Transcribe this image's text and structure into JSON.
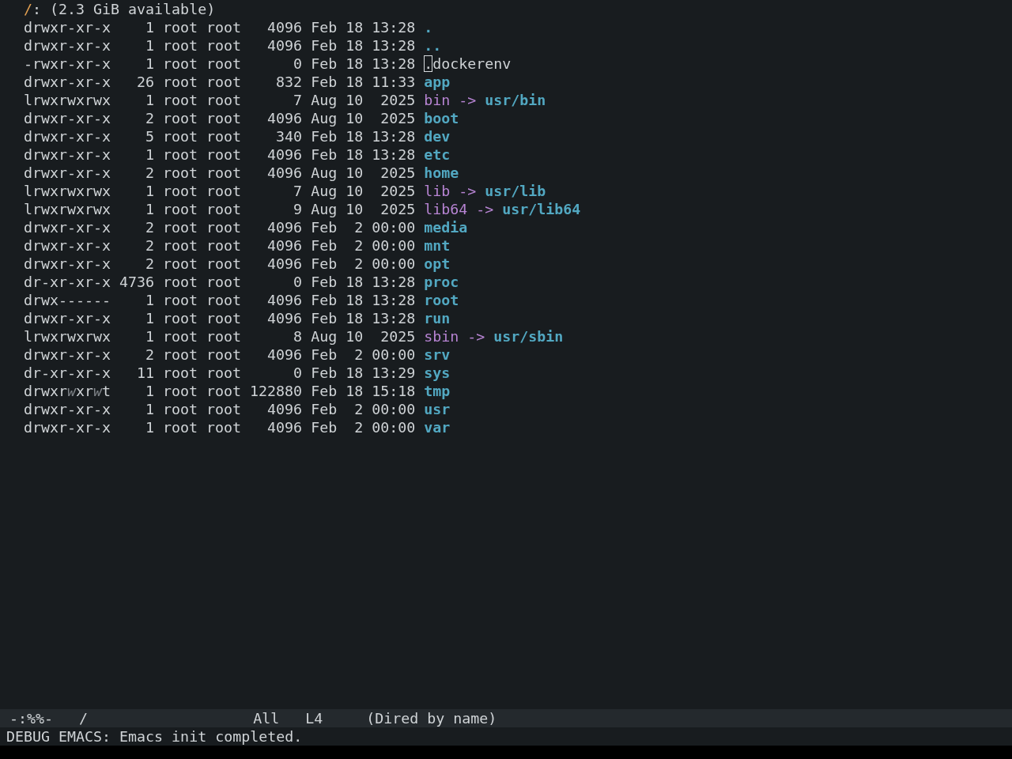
{
  "header": {
    "directory": "/",
    "info": ": (2.3 GiB available)"
  },
  "rows": [
    {
      "kind": "directory",
      "selected": false,
      "permissions": "drwxr-xr-x",
      "links": "1",
      "owner": "root",
      "group": "root",
      "size": "4096",
      "month": "Feb",
      "day": "18",
      "time": "13:28",
      "name": "."
    },
    {
      "kind": "directory",
      "selected": false,
      "permissions": "drwxr-xr-x",
      "links": "1",
      "owner": "root",
      "group": "root",
      "size": "4096",
      "month": "Feb",
      "day": "18",
      "time": "13:28",
      "name": ".."
    },
    {
      "kind": "file",
      "selected": true,
      "permissions": "-rwxr-xr-x",
      "links": "1",
      "owner": "root",
      "group": "root",
      "size": "0",
      "month": "Feb",
      "day": "18",
      "time": "13:28",
      "name": ".dockerenv"
    },
    {
      "kind": "directory",
      "selected": false,
      "permissions": "drwxr-xr-x",
      "links": "26",
      "owner": "root",
      "group": "root",
      "size": "832",
      "month": "Feb",
      "day": "18",
      "time": "11:33",
      "name": "app"
    },
    {
      "kind": "symlink",
      "selected": false,
      "permissions": "lrwxrwxrwx",
      "links": "1",
      "owner": "root",
      "group": "root",
      "size": "7",
      "month": "Aug",
      "day": "10",
      "time": "2025",
      "name": "bin",
      "arrow": "->",
      "target": "usr/bin"
    },
    {
      "kind": "directory",
      "selected": false,
      "permissions": "drwxr-xr-x",
      "links": "2",
      "owner": "root",
      "group": "root",
      "size": "4096",
      "month": "Aug",
      "day": "10",
      "time": "2025",
      "name": "boot"
    },
    {
      "kind": "directory",
      "selected": false,
      "permissions": "drwxr-xr-x",
      "links": "5",
      "owner": "root",
      "group": "root",
      "size": "340",
      "month": "Feb",
      "day": "18",
      "time": "13:28",
      "name": "dev"
    },
    {
      "kind": "directory",
      "selected": false,
      "permissions": "drwxr-xr-x",
      "links": "1",
      "owner": "root",
      "group": "root",
      "size": "4096",
      "month": "Feb",
      "day": "18",
      "time": "13:28",
      "name": "etc"
    },
    {
      "kind": "directory",
      "selected": false,
      "permissions": "drwxr-xr-x",
      "links": "2",
      "owner": "root",
      "group": "root",
      "size": "4096",
      "month": "Aug",
      "day": "10",
      "time": "2025",
      "name": "home"
    },
    {
      "kind": "symlink",
      "selected": false,
      "permissions": "lrwxrwxrwx",
      "links": "1",
      "owner": "root",
      "group": "root",
      "size": "7",
      "month": "Aug",
      "day": "10",
      "time": "2025",
      "name": "lib",
      "arrow": "->",
      "target": "usr/lib"
    },
    {
      "kind": "symlink",
      "selected": false,
      "permissions": "lrwxrwxrwx",
      "links": "1",
      "owner": "root",
      "group": "root",
      "size": "9",
      "month": "Aug",
      "day": "10",
      "time": "2025",
      "name": "lib64",
      "arrow": "->",
      "target": "usr/lib64"
    },
    {
      "kind": "directory",
      "selected": false,
      "permissions": "drwxr-xr-x",
      "links": "2",
      "owner": "root",
      "group": "root",
      "size": "4096",
      "month": "Feb",
      "day": "2",
      "time": "00:00",
      "name": "media"
    },
    {
      "kind": "directory",
      "selected": false,
      "permissions": "drwxr-xr-x",
      "links": "2",
      "owner": "root",
      "group": "root",
      "size": "4096",
      "month": "Feb",
      "day": "2",
      "time": "00:00",
      "name": "mnt"
    },
    {
      "kind": "directory",
      "selected": false,
      "permissions": "drwxr-xr-x",
      "links": "2",
      "owner": "root",
      "group": "root",
      "size": "4096",
      "month": "Feb",
      "day": "2",
      "time": "00:00",
      "name": "opt"
    },
    {
      "kind": "directory",
      "selected": false,
      "permissions": "dr-xr-xr-x",
      "links": "4736",
      "owner": "root",
      "group": "root",
      "size": "0",
      "month": "Feb",
      "day": "18",
      "time": "13:28",
      "name": "proc"
    },
    {
      "kind": "directory",
      "selected": false,
      "permissions": "drwx------",
      "links": "1",
      "owner": "root",
      "group": "root",
      "size": "4096",
      "month": "Feb",
      "day": "18",
      "time": "13:28",
      "name": "root"
    },
    {
      "kind": "directory",
      "selected": false,
      "permissions": "drwxr-xr-x",
      "links": "1",
      "owner": "root",
      "group": "root",
      "size": "4096",
      "month": "Feb",
      "day": "18",
      "time": "13:28",
      "name": "run"
    },
    {
      "kind": "symlink",
      "selected": false,
      "permissions": "lrwxrwxrwx",
      "links": "1",
      "owner": "root",
      "group": "root",
      "size": "8",
      "month": "Aug",
      "day": "10",
      "time": "2025",
      "name": "sbin",
      "arrow": "->",
      "target": "usr/sbin"
    },
    {
      "kind": "directory",
      "selected": false,
      "permissions": "drwxr-xr-x",
      "links": "2",
      "owner": "root",
      "group": "root",
      "size": "4096",
      "month": "Feb",
      "day": "2",
      "time": "00:00",
      "name": "srv"
    },
    {
      "kind": "directory",
      "selected": false,
      "permissions": "dr-xr-xr-x",
      "links": "11",
      "owner": "root",
      "group": "root",
      "size": "0",
      "month": "Feb",
      "day": "18",
      "time": "13:29",
      "name": "sys"
    },
    {
      "kind": "directory",
      "selected": false,
      "permissions": [
        {
          "text": "drwxr",
          "dim": false
        },
        {
          "text": "w",
          "dim": true
        },
        {
          "text": "xr",
          "dim": false
        },
        {
          "text": "w",
          "dim": true
        },
        {
          "text": "t",
          "dim": false
        }
      ],
      "links": "1",
      "owner": "root",
      "group": "root",
      "size": "122880",
      "month": "Feb",
      "day": "18",
      "time": "15:18",
      "name": "tmp"
    },
    {
      "kind": "directory",
      "selected": false,
      "permissions": "drwxr-xr-x",
      "links": "1",
      "owner": "root",
      "group": "root",
      "size": "4096",
      "month": "Feb",
      "day": "2",
      "time": "00:00",
      "name": "usr"
    },
    {
      "kind": "directory",
      "selected": false,
      "permissions": "drwxr-xr-x",
      "links": "1",
      "owner": "root",
      "group": "root",
      "size": "4096",
      "month": "Feb",
      "day": "2",
      "time": "00:00",
      "name": "var"
    }
  ],
  "mode_line": {
    "status": "-:%%-",
    "buffer": "/",
    "position": "All",
    "line": "L4",
    "mode": "(Dired by name)"
  },
  "echo_area": {
    "message": "DEBUG EMACS: Emacs init completed."
  }
}
